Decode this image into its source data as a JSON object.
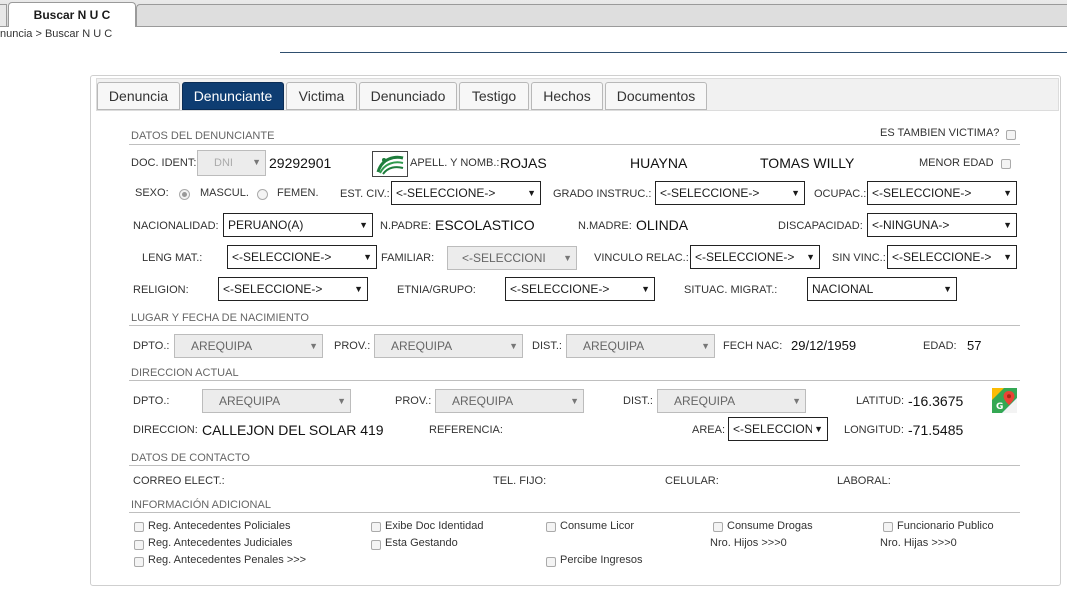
{
  "top_tab": {
    "label": "Buscar N U C"
  },
  "breadcrumb": "nuncia > Buscar N U C",
  "tabs": [
    "Denuncia",
    "Denunciante",
    "Victima",
    "Denunciado",
    "Testigo",
    "Hechos",
    "Documentos"
  ],
  "active_tab": "Denunciante",
  "colors": {
    "active_tab": "#0e3d72",
    "section_text": "#666666"
  },
  "sections": {
    "datos": "DATOS DEL DENUNCIANTE",
    "lugar": "LUGAR Y FECHA DE NACIMIENTO",
    "direccion": "DIRECCION ACTUAL",
    "contacto": "DATOS DE CONTACTO",
    "info": "INFORMACIÓN ADICIONAL"
  },
  "victim_question": "ES TAMBIEN VICTIMA?",
  "doc": {
    "label": "DOC. IDENT:",
    "type": "DNI",
    "number": "29292901"
  },
  "reniec_icon": "reniec-logo-icon",
  "name": {
    "label": "APELL. Y NOMB.:",
    "apellido_paterno": "ROJAS",
    "apellido_materno": "HUAYNA",
    "nombres": "TOMAS WILLY"
  },
  "menor_edad": "MENOR EDAD",
  "sexo": {
    "label": "SEXO:",
    "masc": "MASCUL.",
    "fem": "FEMEN.",
    "selected": "MASCUL."
  },
  "est_civ": {
    "label": "EST. CIV.:",
    "value": "<-SELECCIONE->"
  },
  "grado": {
    "label": "GRADO INSTRUC.:",
    "value": "<-SELECCIONE->"
  },
  "ocupac": {
    "label": "OCUPAC.:",
    "value": "<-SELECCIONE->"
  },
  "nacionalidad": {
    "label": "NACIONALIDAD:",
    "value": "PERUANO(A)"
  },
  "npadre": {
    "label": "N.PADRE:",
    "value": "ESCOLASTICO"
  },
  "nmadre": {
    "label": "N.MADRE:",
    "value": "OLINDA"
  },
  "discapacidad": {
    "label": "DISCAPACIDAD:",
    "value": "<-NINGUNA->"
  },
  "leng_mat": {
    "label": "LENG MAT.:",
    "value": "<-SELECCIONE->"
  },
  "familiar": {
    "label": "FAMILIAR:",
    "value": "<-SELECCIONI"
  },
  "vinculo": {
    "label": "VINCULO RELAC.:",
    "value": "<-SELECCIONE->"
  },
  "sin_vinc": {
    "label": "SIN VINC.:",
    "value": "<-SELECCIONE->"
  },
  "religion": {
    "label": "RELIGION:",
    "value": "<-SELECCIONE->"
  },
  "etnia": {
    "label": "ETNIA/GRUPO:",
    "value": "<-SELECCIONE->"
  },
  "situac": {
    "label": "SITUAC. MIGRAT.:",
    "value": "NACIONAL"
  },
  "nacimiento": {
    "dpto_label": "DPTO.:",
    "dpto": "AREQUIPA",
    "prov_label": "PROV.:",
    "prov": "AREQUIPA",
    "dist_label": "DIST.:",
    "dist": "AREQUIPA",
    "fech_label": "FECH NAC:",
    "fecha": "29/12/1959",
    "edad_label": "EDAD:",
    "edad": "57"
  },
  "direccion_actual": {
    "dpto_label": "DPTO.:",
    "dpto": "AREQUIPA",
    "prov_label": "PROV.:",
    "prov": "AREQUIPA",
    "dist_label": "DIST.:",
    "dist": "AREQUIPA",
    "lat_label": "LATITUD:",
    "lat": "-16.3675",
    "dir_label": "DIRECCION:",
    "direccion": "CALLEJON DEL SOLAR 419",
    "ref_label": "REFERENCIA:",
    "area_label": "AREA:",
    "area": "<-SELECCION",
    "lon_label": "LONGITUD:",
    "lon": "-71.5485"
  },
  "contacto": {
    "correo": "CORREO ELECT.:",
    "tel": "TEL. FIJO:",
    "celular": "CELULAR:",
    "laboral": "LABORAL:"
  },
  "info": {
    "pol": "Reg. Antecedentes Policiales",
    "jud": "Reg. Antecedentes Judiciales",
    "pen": "Reg. Antecedentes Penales  >>>",
    "exibe": "Exibe Doc Identidad",
    "gestando": "Esta Gestando",
    "licor": "Consume Licor",
    "percibe": "Percibe Ingresos",
    "drogas": "Consume Drogas",
    "hijos": "Nro. Hijos >>>0",
    "func": "Funcionario Publico",
    "hijas": "Nro. Hijas >>>0"
  }
}
